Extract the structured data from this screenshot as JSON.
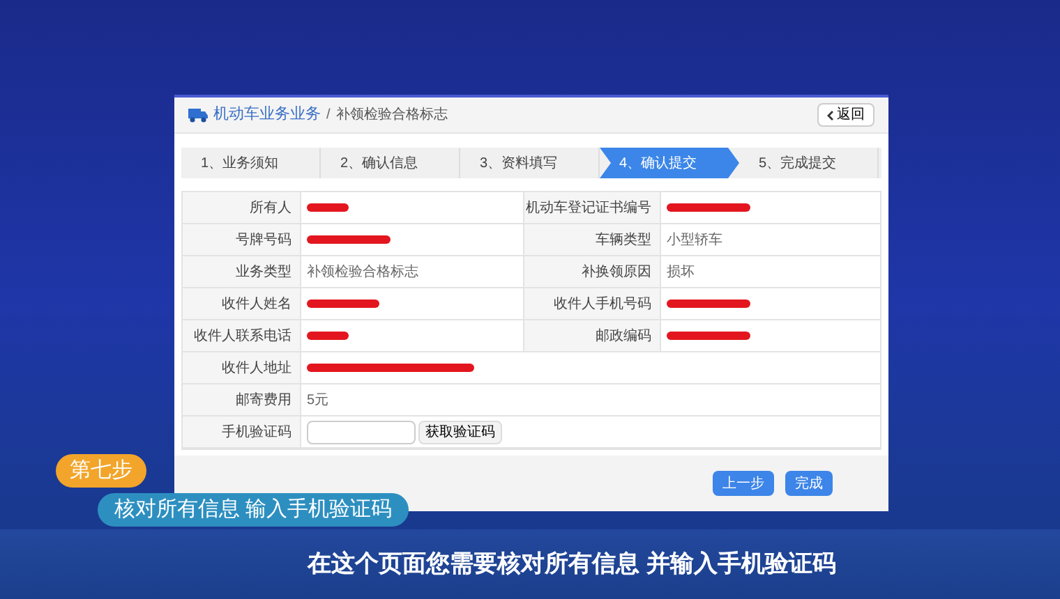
{
  "header": {
    "section": "机动车业务业务",
    "separator": "/",
    "page": "补领检验合格标志",
    "back_button": "返回"
  },
  "steps": [
    {
      "label": "1、业务须知",
      "selected": false
    },
    {
      "label": "2、确认信息",
      "selected": false
    },
    {
      "label": "3、资料填写",
      "selected": false
    },
    {
      "label": "4、确认提交",
      "selected": true
    },
    {
      "label": "5、完成提交",
      "selected": false
    }
  ],
  "rows": [
    [
      {
        "label": "所有人",
        "kind": "redacted"
      },
      {
        "label": "机动车登记证书编号",
        "kind": "redacted"
      }
    ],
    [
      {
        "label": "号牌号码",
        "kind": "redacted"
      },
      {
        "label": "车辆类型",
        "kind": "text",
        "value": "小型轿车"
      }
    ],
    [
      {
        "label": "业务类型",
        "kind": "text",
        "value": "补领检验合格标志"
      },
      {
        "label": "补换领原因",
        "kind": "text",
        "value": "损坏"
      }
    ],
    [
      {
        "label": "收件人姓名",
        "kind": "redacted"
      },
      {
        "label": "收件人手机号码",
        "kind": "redacted"
      }
    ],
    [
      {
        "label": "收件人联系电话",
        "kind": "redacted"
      },
      {
        "label": "邮政编码",
        "kind": "redacted"
      }
    ],
    [
      {
        "label": "收件人地址",
        "kind": "redacted"
      }
    ],
    [
      {
        "label": "邮寄费用",
        "kind": "text",
        "value": "5元"
      }
    ],
    [
      {
        "label": "手机验证码",
        "kind": "code",
        "button": "获取验证码"
      }
    ]
  ],
  "footer_buttons": [
    "上一步",
    "完成"
  ],
  "captions": {
    "step_badge": "第七步",
    "step_title": "核对所有信息 输入手机验证码",
    "subtitle": "在这个页面您需要核对所有信息 并输入手机验证码"
  }
}
